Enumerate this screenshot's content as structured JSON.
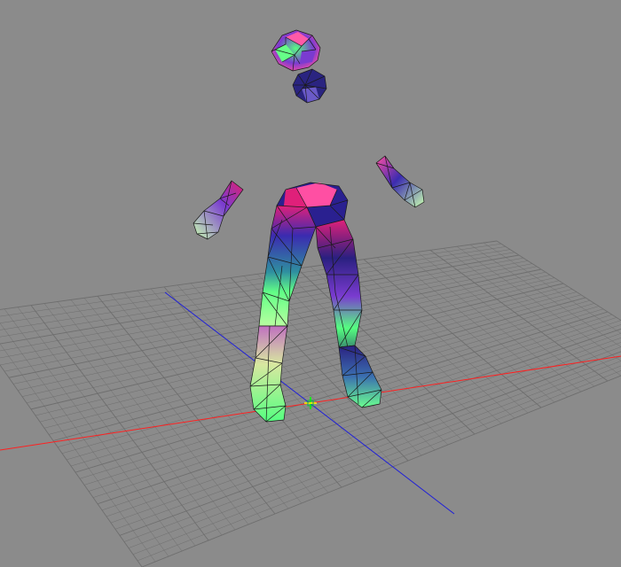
{
  "viewport": {
    "background_color": "#8b8b8b",
    "grid_color": "#6e6e6e",
    "x_axis_color": "#ff2020",
    "z_axis_color": "#2020d8",
    "origin_gizmo_colors": [
      "#00ff00",
      "#ffff00"
    ],
    "grid_visible": true
  },
  "model": {
    "render_mode": "wireframe-shaded",
    "part_names": [
      "hair-bun",
      "head",
      "left-forearm",
      "right-forearm",
      "pelvis",
      "left-leg",
      "right-leg",
      "left-boot",
      "right-boot"
    ],
    "palette": [
      "#ff4fa3",
      "#3b2bb0",
      "#55ff80",
      "#c8ff9a",
      "#e02070",
      "#1e1a70",
      "#7a3bd0"
    ]
  }
}
